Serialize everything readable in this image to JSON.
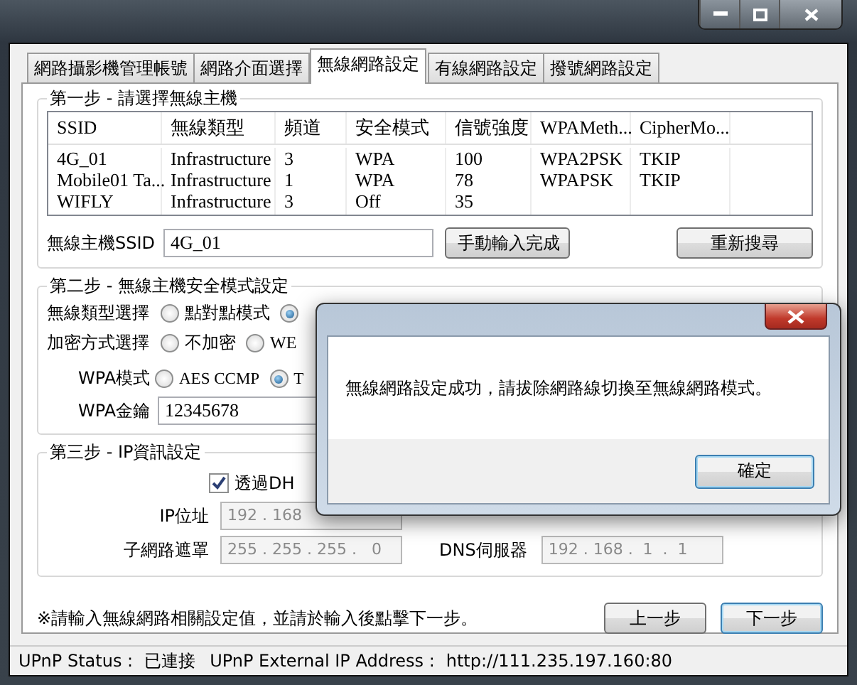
{
  "tabs": [
    {
      "label": "網路攝影機管理帳號",
      "selected": false
    },
    {
      "label": "網路介面選擇",
      "selected": false
    },
    {
      "label": "無線網路設定",
      "selected": true
    },
    {
      "label": "有線網路設定",
      "selected": false
    },
    {
      "label": "撥號網路設定",
      "selected": false
    }
  ],
  "step1": {
    "legend": "第一步 - 請選擇無線主機",
    "columns": [
      "SSID",
      "無線類型",
      "頻道",
      "安全模式",
      "信號強度",
      "WPAMeth...",
      "CipherMo..."
    ],
    "rows": [
      [
        "4G_01",
        "Infrastructure",
        "3",
        "WPA",
        "100",
        "WPA2PSK",
        "TKIP"
      ],
      [
        "Mobile01 Ta...",
        "Infrastructure",
        "1",
        "WPA",
        "78",
        "WPAPSK",
        "TKIP"
      ],
      [
        "WIFLY",
        "Infrastructure",
        "3",
        "Off",
        "35",
        "",
        ""
      ]
    ],
    "ssid_label": "無線主機SSID",
    "ssid_value": "4G_01",
    "manual_button": "手動輸入完成",
    "rescan_button": "重新搜尋"
  },
  "step2": {
    "legend": "第二步 - 無線主機安全模式設定",
    "groups": [
      {
        "label": "無線類型選擇",
        "options": [
          {
            "label": "點對點模式",
            "selected": false
          },
          {
            "selected": true
          }
        ]
      },
      {
        "label": "加密方式選擇",
        "options": [
          {
            "label": "不加密",
            "selected": false
          },
          {
            "label": "WE",
            "selected": false
          }
        ]
      },
      {
        "label": "WPA模式",
        "options": [
          {
            "label": "AES CCMP",
            "selected": false
          },
          {
            "label": "T",
            "selected": true
          }
        ]
      }
    ],
    "key_label": "WPA金鑰",
    "key_value": "12345678"
  },
  "step3": {
    "legend": "第三步 - IP資訊設定",
    "dhcp": {
      "label": "透過DH",
      "checked": true
    },
    "ip_label": "IP位址",
    "ip_value": "192 . 168",
    "disabled": true,
    "mask_label": "子網路遮罩",
    "mask_value": "255 . 255 . 255 .   0",
    "dns_label": "DNS伺服器",
    "dns_value": "192 . 168 .  1  .  1"
  },
  "note": "※請輸入無線網路相關設定值，並請於輸入後點擊下一步。",
  "prev_button": "上一步",
  "next_button": "下一步",
  "status_bar": [
    {
      "label": "UPnP Status :",
      "value": "已連接"
    },
    {
      "label": "UPnP External IP Address :",
      "value": "http://111.235.197.160:80"
    }
  ],
  "dialog": {
    "message": "無線網路設定成功，請拔除網路線切換至無線網路模式。",
    "ok_button": "確定"
  }
}
